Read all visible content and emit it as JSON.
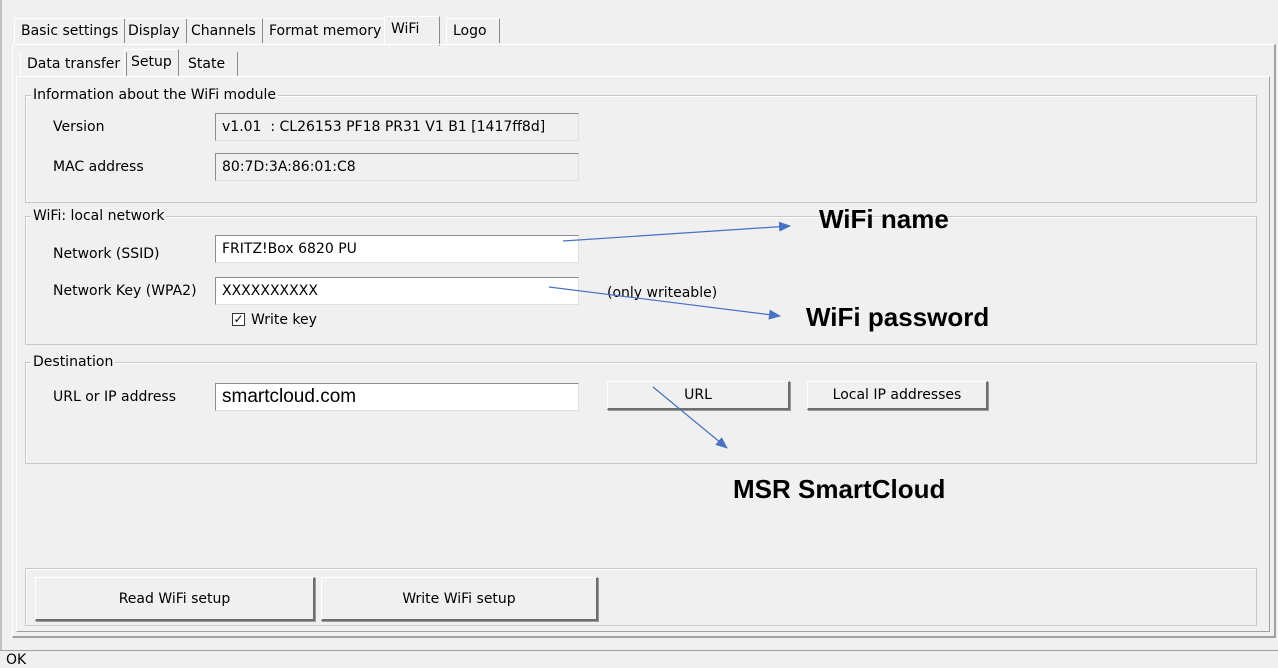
{
  "tabs": [
    "Basic settings",
    "Display",
    "Channels",
    "Format memory",
    "WiFi",
    "Logo"
  ],
  "active_tab": "WiFi",
  "sub_tabs": [
    "Data transfer",
    "Setup",
    "State"
  ],
  "active_sub_tab": "Setup",
  "module_info": {
    "title": "Information about the WiFi module",
    "version_label": "Version",
    "version_value": "v1.01  : CL26153 PF18 PR31 V1 B1 [1417ff8d]",
    "mac_label": "MAC address",
    "mac_value": "80:7D:3A:86:01:C8"
  },
  "local_network": {
    "title": "WiFi: local network",
    "ssid_label": "Network (SSID)",
    "ssid_value": "FRITZ!Box 6820 PU",
    "key_label": "Network Key (WPA2)",
    "key_value": "XXXXXXXXXX",
    "key_hint": "(only writeable)",
    "write_key_label": "Write key",
    "write_key_checked": true
  },
  "destination": {
    "title": "Destination",
    "url_label": "URL or IP address",
    "url_value": "smartcloud.com",
    "url_button": "URL",
    "local_ip_button": "Local IP addresses"
  },
  "actions": {
    "read_button": "Read WiFi setup",
    "write_button": "Write WiFi setup"
  },
  "annotations": {
    "wifi_name": "WiFi name",
    "wifi_password": "WiFi password",
    "msr_smartcloud": "MSR SmartCloud",
    "arrow_color": "#4472c4"
  },
  "status": "OK"
}
